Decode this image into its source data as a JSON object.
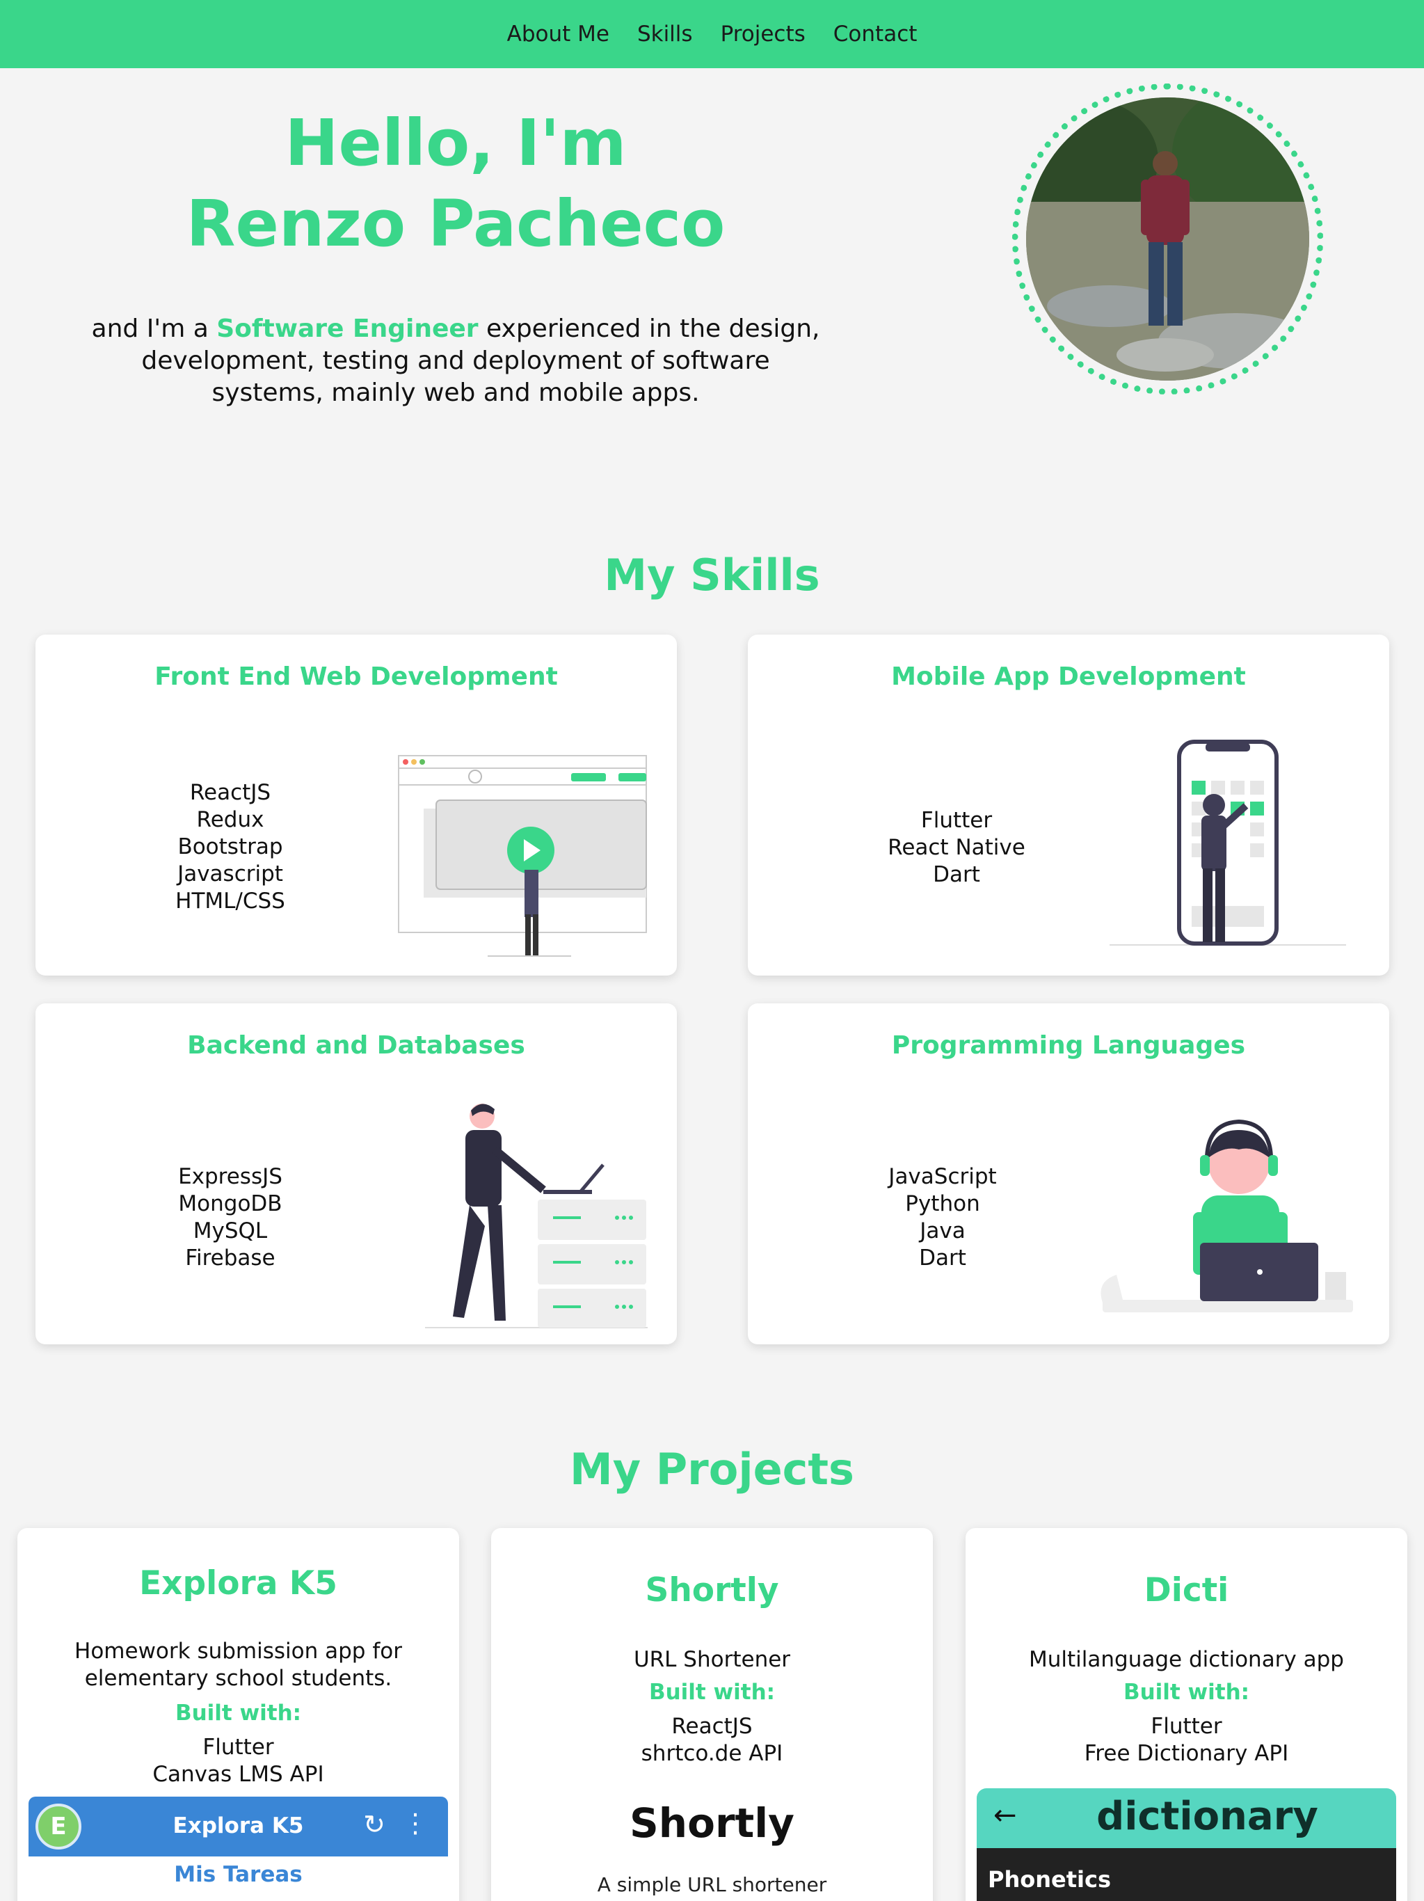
{
  "nav": {
    "items": [
      "About Me",
      "Skills",
      "Projects",
      "Contact"
    ]
  },
  "hero": {
    "greeting": "Hello, I'm",
    "name": "Renzo Pacheco",
    "desc_pre": "and I'm a ",
    "desc_highlight": "Software Engineer",
    "desc_post": " experienced in the design, development, testing and deployment of software systems, mainly web and mobile apps."
  },
  "skills": {
    "title": "My Skills",
    "cards": [
      {
        "title": "Front End Web Development",
        "items": [
          "ReactJS",
          "Redux",
          "Bootstrap",
          "Javascript",
          "HTML/CSS"
        ]
      },
      {
        "title": "Mobile App Development",
        "items": [
          "Flutter",
          "React Native",
          "Dart"
        ]
      },
      {
        "title": "Backend and Databases",
        "items": [
          "ExpressJS",
          "MongoDB",
          "MySQL",
          "Firebase"
        ]
      },
      {
        "title": "Programming Languages",
        "items": [
          "JavaScript",
          "Python",
          "Java",
          "Dart"
        ]
      }
    ]
  },
  "projects": {
    "title": "My Projects",
    "built_with_label": "Built with:",
    "cards": [
      {
        "title": "Explora K5",
        "desc": "Homework submission app for elementary school students.",
        "tech": [
          "Flutter",
          "Canvas LMS API"
        ],
        "preview": {
          "app_title": "Explora K5",
          "logo_letter": "E",
          "subtitle": "Mis Tareas"
        }
      },
      {
        "title": "Shortly",
        "desc": "URL Shortener",
        "tech": [
          "ReactJS",
          "shrtco.de API"
        ],
        "preview": {
          "logo": "Shortly",
          "subtitle": "A simple URL shortener"
        }
      },
      {
        "title": "Dicti",
        "desc": "Multilanguage dictionary app",
        "tech": [
          "Flutter",
          "Free Dictionary API"
        ],
        "preview": {
          "app_title": "dictionary",
          "section": "Phonetics"
        }
      }
    ]
  },
  "colors": {
    "accent": "#3ad68a",
    "background": "#f4f4f4",
    "explora_blue": "#3a86d6",
    "dicti_teal": "#56d6c0"
  }
}
